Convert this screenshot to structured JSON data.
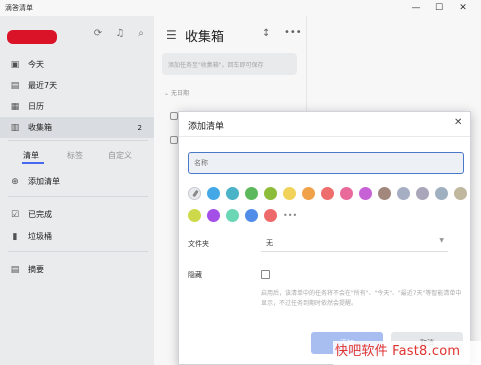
{
  "app": {
    "title": "滴答清单"
  },
  "window_controls": {
    "minimize": "—",
    "maximize": "☐",
    "close": "✕"
  },
  "sidebar": {
    "nav": [
      {
        "label": "今天",
        "icon": "calendar-today-icon",
        "glyph": "▣"
      },
      {
        "label": "最近7天",
        "icon": "calendar-week-icon",
        "glyph": "▤"
      },
      {
        "label": "日历",
        "icon": "calendar-icon",
        "glyph": "▦"
      },
      {
        "label": "收集箱",
        "icon": "inbox-icon",
        "glyph": "▥",
        "count": "2"
      }
    ],
    "tabs": [
      "清单",
      "标签",
      "自定义"
    ],
    "actions": [
      {
        "label": "添加清单",
        "icon": "add-circle-icon",
        "glyph": "⊕"
      },
      {
        "label": "已完成",
        "icon": "checkbox-done-icon",
        "glyph": "☑"
      },
      {
        "label": "垃圾桶",
        "icon": "trash-icon",
        "glyph": "▮"
      },
      {
        "label": "摘要",
        "icon": "summary-icon",
        "glyph": "▤"
      }
    ]
  },
  "middle": {
    "title": "收集箱",
    "add_task_placeholder": "添加任务至\"收集箱\"，回车即可保存",
    "group_label": "无日期"
  },
  "dialog": {
    "title": "添加清单",
    "name_placeholder": "名称",
    "colors": [
      "#45a8e6",
      "#4bb3c7",
      "#5cb85c",
      "#8dbb3a",
      "#f2d35a",
      "#f0a24b",
      "#ee6d6d",
      "#e8699a",
      "#c661d6",
      "#a2877d",
      "#a6aec3",
      "#a9a6b9",
      "#9fb1c0",
      "#bfb79e",
      "#cdd94b",
      "#a44fe8",
      "#6ad6b4",
      "#4f8de8",
      "#ee6a6a"
    ],
    "more_glyph": "•••",
    "folder_label": "文件夹",
    "folder_value": "无",
    "hidden_label": "隐藏",
    "hidden_desc": "启用后，该清单中的任务将不会在\"所有\"、\"今天\"、\"最近7天\"等智能清单中显示，不过任务到期时依然会提醒。",
    "add_button": "添加",
    "cancel_button": "取消"
  },
  "watermark": "快吧软件 Fast8.com"
}
